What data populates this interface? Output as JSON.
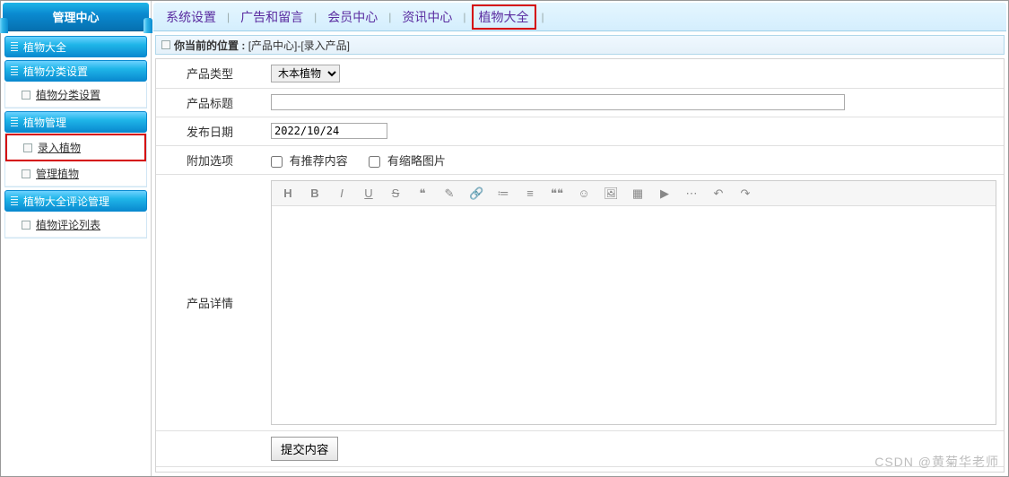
{
  "sidebar": {
    "title": "管理中心",
    "sections": [
      {
        "title": "植物大全",
        "items": []
      },
      {
        "title": "植物分类设置",
        "items": [
          {
            "label": "植物分类设置"
          }
        ]
      },
      {
        "title": "植物管理",
        "items": [
          {
            "label": "录入植物",
            "selected": true
          },
          {
            "label": "管理植物"
          }
        ]
      },
      {
        "title": "植物大全评论管理",
        "items": [
          {
            "label": "植物评论列表"
          }
        ]
      }
    ]
  },
  "topnav": {
    "tabs": [
      {
        "label": "系统设置"
      },
      {
        "label": "广告和留言"
      },
      {
        "label": "会员中心"
      },
      {
        "label": "资讯中心"
      },
      {
        "label": "植物大全",
        "active": true
      }
    ],
    "separator": "|"
  },
  "breadcrumb": {
    "prefix": "你当前的位置 :",
    "path": "[产品中心]-[录入产品]"
  },
  "form": {
    "type_label": "产品类型",
    "type_value": "木本植物",
    "title_label": "产品标题",
    "title_value": "",
    "date_label": "发布日期",
    "date_value": "2022/10/24",
    "options_label": "附加选项",
    "option_recommend": "有推荐内容",
    "option_thumb": "有缩略图片",
    "detail_label": "产品详情",
    "submit_label": "提交内容"
  },
  "editor_toolbar": [
    "H",
    "B",
    "I",
    "U",
    "S",
    "❝",
    "✎",
    "🔗",
    "≔",
    "≡",
    "❝❝",
    "☺",
    "🖼",
    "▦",
    "▶",
    "⋯",
    "↶",
    "↷"
  ],
  "watermark": "CSDN @黄菊华老师"
}
